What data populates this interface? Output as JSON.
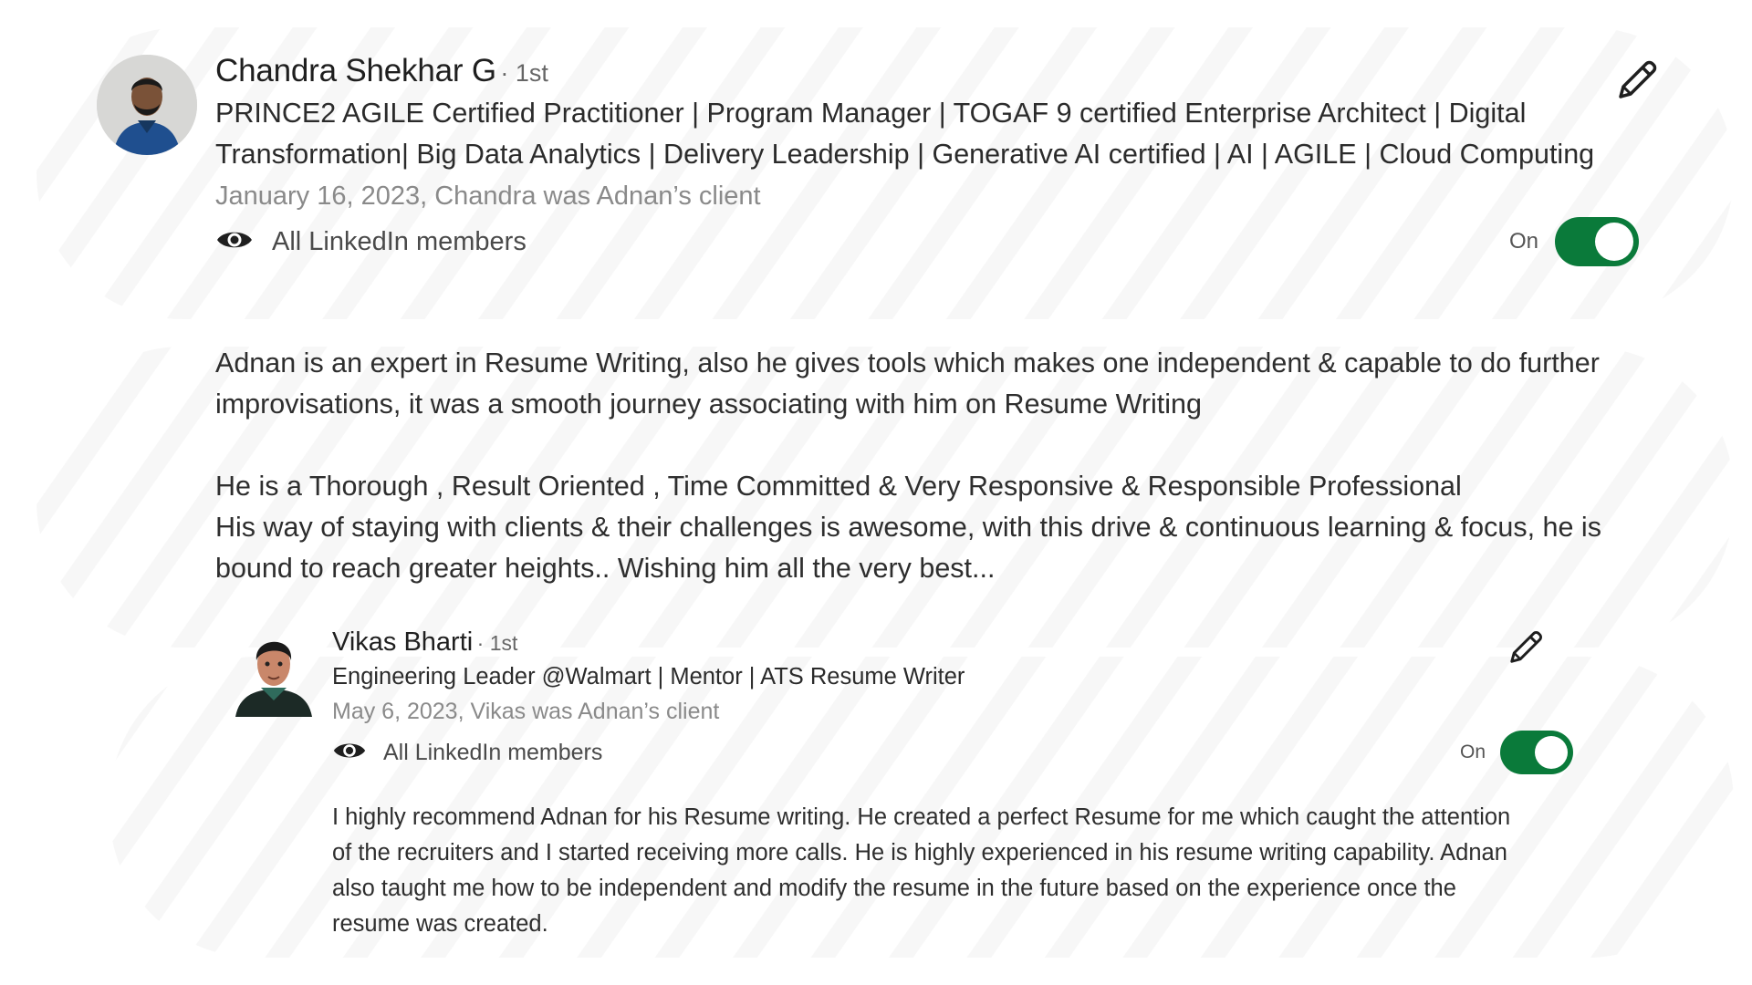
{
  "colors": {
    "toggle_on": "#0a7a3a",
    "name_text": "#1f1f1f",
    "meta_text": "#8a8a8a"
  },
  "recommendations": [
    {
      "name": "Chandra Shekhar G",
      "degree": "· 1st",
      "headline": "PRINCE2 AGILE Certified Practitioner | Program Manager | TOGAF 9 certified Enterprise Architect | Digital Transformation| Big Data Analytics | Delivery Leadership | Generative AI certified | AI | AGILE | Cloud Computing",
      "meta": "January 16, 2023, Chandra was Adnan’s client",
      "visibility_icon": "eye-icon",
      "visibility": "All LinkedIn members",
      "toggle_label": "On",
      "toggle_on": true,
      "edit_icon": "pencil-icon",
      "body": [
        "Adnan is an expert in Resume Writing, also he gives tools which makes one independent & capable to do further improvisations, it was a smooth journey associating with him on Resume Writing",
        "He is a Thorough , Result Oriented , Time Committed & Very Responsive & Responsible Professional",
        "His way of staying with clients & their challenges is awesome, with this drive & continuous learning & focus, he is bound to reach greater heights.. Wishing him all the very best..."
      ]
    },
    {
      "name": "Vikas Bharti",
      "degree": "· 1st",
      "headline": "Engineering Leader @Walmart | Mentor | ATS Resume Writer",
      "meta": "May 6, 2023, Vikas was Adnan’s client",
      "visibility_icon": "eye-icon",
      "visibility": "All LinkedIn members",
      "toggle_label": "On",
      "toggle_on": true,
      "edit_icon": "pencil-icon",
      "body": [
        "I highly recommend Adnan for his Resume writing. He created a perfect Resume for me which caught the attention of the recruiters and I started receiving more calls. He is highly experienced in his resume writing capability. Adnan also taught me how to be independent and modify the resume in the future based on the experience once the resume was created."
      ]
    }
  ]
}
